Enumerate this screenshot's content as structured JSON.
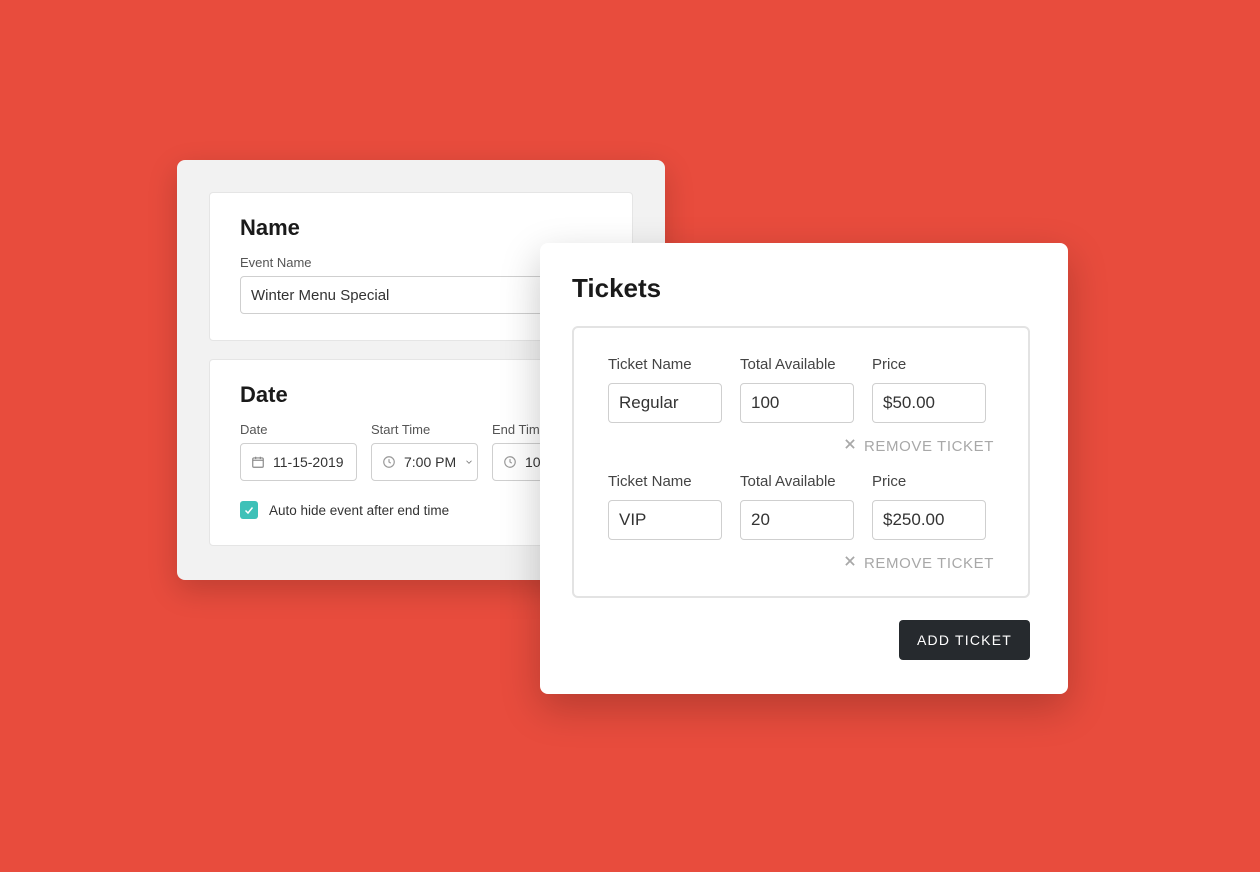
{
  "name_section": {
    "title": "Name",
    "event_name_label": "Event Name",
    "event_name_value": "Winter Menu Special"
  },
  "date_section": {
    "title": "Date",
    "date_label": "Date",
    "date_value": "11-15-2019",
    "start_time_label": "Start Time",
    "start_time_value": "7:00 PM",
    "end_time_label": "End Tim",
    "end_time_value": "10",
    "auto_hide_label": "Auto hide event after end time",
    "auto_hide_checked": true
  },
  "tickets_section": {
    "title": "Tickets",
    "name_label": "Ticket Name",
    "avail_label": "Total Available",
    "price_label": "Price",
    "remove_label": "REMOVE TICKET",
    "add_label": "ADD TICKET",
    "tickets": [
      {
        "name": "Regular",
        "available": "100",
        "price": "$50.00"
      },
      {
        "name": "VIP",
        "available": "20",
        "price": "$250.00"
      }
    ]
  }
}
